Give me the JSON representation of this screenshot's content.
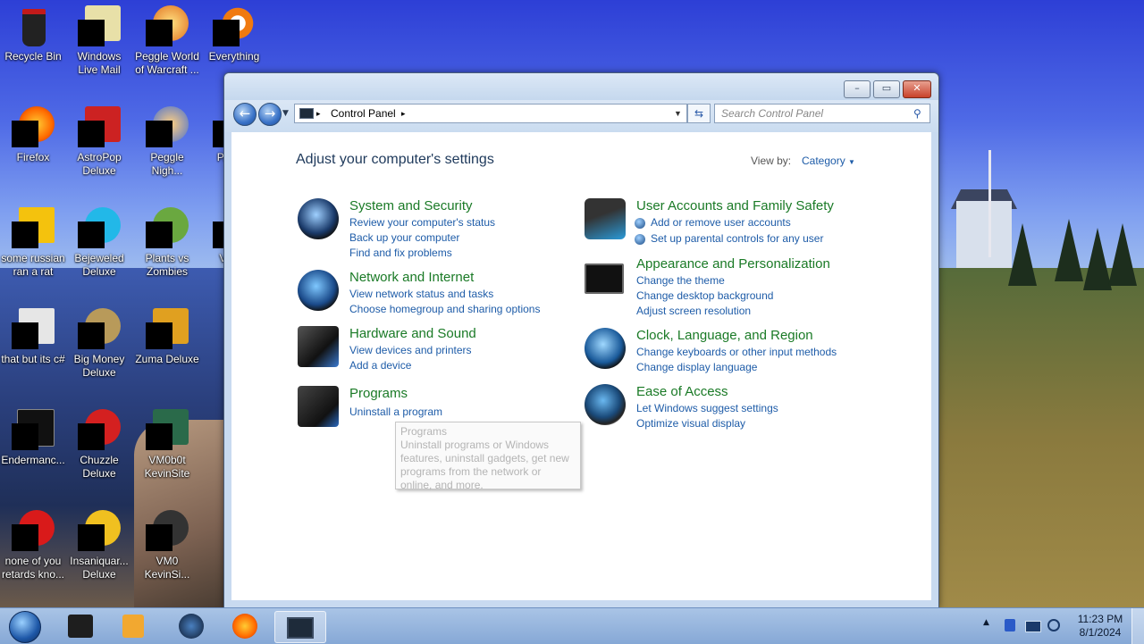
{
  "desktop_icons": [
    {
      "label": "Recycle Bin",
      "icon": "recycle-bin-icon"
    },
    {
      "label": "Windows Live Mail",
      "icon": "windows-live-mail-icon"
    },
    {
      "label": "Peggle World of Warcraft ...",
      "icon": "peggle-wow-icon"
    },
    {
      "label": "Everything",
      "icon": "everything-search-icon"
    },
    {
      "label": "Firefox",
      "icon": "firefox-icon"
    },
    {
      "label": "AstroPop Deluxe",
      "icon": "astropop-icon"
    },
    {
      "label": "Peggle Nigh...",
      "icon": "peggle-nights-icon"
    },
    {
      "label": "P... D...",
      "icon": "partial-icon"
    },
    {
      "label": "some russian ran a rat",
      "icon": "text-file-icon"
    },
    {
      "label": "Bejeweled Deluxe",
      "icon": "bejeweled-icon"
    },
    {
      "label": "Plants vs Zombies",
      "icon": "plants-vs-zombies-icon"
    },
    {
      "label": "Visu...",
      "icon": "partial-icon"
    },
    {
      "label": "that but its c#",
      "icon": "stacked-windows-icon"
    },
    {
      "label": "Big Money Deluxe",
      "icon": "big-money-icon"
    },
    {
      "label": "Zuma Deluxe",
      "icon": "zuma-icon"
    },
    {
      "label": "Endermanc...",
      "icon": "console-icon"
    },
    {
      "label": "Chuzzle Deluxe",
      "icon": "chuzzle-icon"
    },
    {
      "label": "VM0b0t KevinSite",
      "icon": "vm-icon"
    },
    {
      "label": "none of you retards kno...",
      "icon": "red-icon"
    },
    {
      "label": "Insaniquar... Deluxe",
      "icon": "insaniquarium-icon"
    },
    {
      "label": "VM0 KevinSi...",
      "icon": "vm-icon"
    }
  ],
  "window": {
    "address": {
      "root_arrow": "▸",
      "crumb": "Control Panel",
      "crumb_arrow": "▸"
    },
    "search_placeholder": "Search Control Panel",
    "heading": "Adjust your computer's settings",
    "view_by_label": "View by:",
    "view_by_value": "Category",
    "categories": [
      {
        "title": "System and Security",
        "icon": "system-security-icon",
        "links": [
          "Review your computer's status",
          "Back up your computer",
          "Find and fix problems"
        ]
      },
      {
        "title": "Network and Internet",
        "icon": "network-globe-icon",
        "links": [
          "View network status and tasks",
          "Choose homegroup and sharing options"
        ]
      },
      {
        "title": "Hardware and Sound",
        "icon": "hardware-sound-icon",
        "links": [
          "View devices and printers",
          "Add a device"
        ]
      },
      {
        "title": "Programs",
        "icon": "programs-icon",
        "links": [
          "Uninstall a program"
        ]
      },
      {
        "title": "User Accounts and Family Safety",
        "icon": "user-accounts-icon",
        "links": [
          "Add or remove user accounts",
          "Set up parental controls for any user"
        ]
      },
      {
        "title": "Appearance and Personalization",
        "icon": "appearance-monitor-icon",
        "links": [
          "Change the theme",
          "Change desktop background",
          "Adjust screen resolution"
        ]
      },
      {
        "title": "Clock, Language, and Region",
        "icon": "clock-globe-icon",
        "links": [
          "Change keyboards or other input methods",
          "Change display language"
        ]
      },
      {
        "title": "Ease of Access",
        "icon": "ease-of-access-icon",
        "links": [
          "Let Windows suggest settings",
          "Optimize visual display"
        ]
      }
    ],
    "tooltip": {
      "title": "Programs",
      "text": "Uninstall programs or Windows features, uninstall gadgets, get new programs from the network or online, and more."
    }
  },
  "taskbar": {
    "items": [
      "start-orb-icon",
      "app-dark-icon",
      "media-player-icon",
      "globe-app-icon",
      "firefox-icon",
      "control-panel-icon"
    ],
    "time": "11:23 PM",
    "date": "8/1/2024"
  },
  "colors": {
    "link": "#1e5ca8",
    "category_title": "#1a7a26",
    "heading": "#1e395b"
  }
}
